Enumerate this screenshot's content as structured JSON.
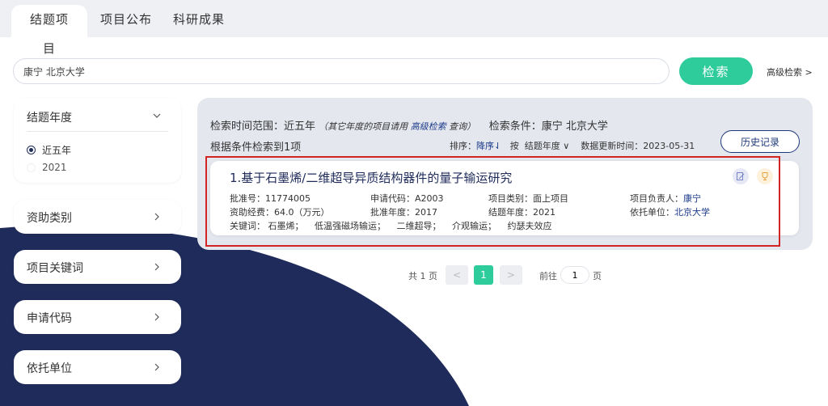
{
  "tabs": [
    "结题项目",
    "项目公布",
    "科研成果"
  ],
  "search": {
    "value": "康宁 北京大学",
    "button": "检索",
    "advanced": "高级检索 >"
  },
  "sidebar": {
    "year": {
      "title": "结题年度",
      "options": [
        "近五年",
        "2021"
      ],
      "selected": "近五年"
    },
    "filters": [
      "资助类别",
      "项目关键词",
      "申请代码",
      "依托单位"
    ]
  },
  "results": {
    "time_label": "检索时间范围：近五年",
    "note_pre": "（其它年度的项目请用 ",
    "note_link": "高级检索",
    "note_post": " 查询）",
    "condition": "检索条件：康宁 北京大学",
    "count": "根据条件检索到1项",
    "sort_label": "排序：",
    "sort_value": "降序⇃",
    "by_label": "按",
    "sort_field": "结题年度 ∨",
    "updated": "数据更新时间：2023-05-31",
    "history_button": "历史记录"
  },
  "result_item": {
    "title": "1.基于石墨烯/二维超导异质结构器件的量子输运研究",
    "approval_no": "批准号：11774005",
    "apply_code": "申请代码：A2003",
    "project_type": "项目类别：面上项目",
    "leader_label": "项目负责人：",
    "leader": "康宁",
    "funding": "资助经费：64.0（万元）",
    "approval_year": "批准年度：2017",
    "end_year": "结题年度：2021",
    "unit_label": "依托单位：",
    "unit": "北京大学",
    "keywords_label": "关键词：",
    "keywords": [
      "石墨烯；",
      "低温强磁场输运；",
      "二维超导；",
      "介观输运；",
      "约瑟夫效应"
    ]
  },
  "pagination": {
    "total": "共 1 页",
    "current": "1",
    "goto": "前往",
    "input": "1",
    "page": "页"
  },
  "colors": {
    "accent": "#2ecc9a",
    "navy": "#1f2b5a",
    "highlight": "#d32424"
  }
}
